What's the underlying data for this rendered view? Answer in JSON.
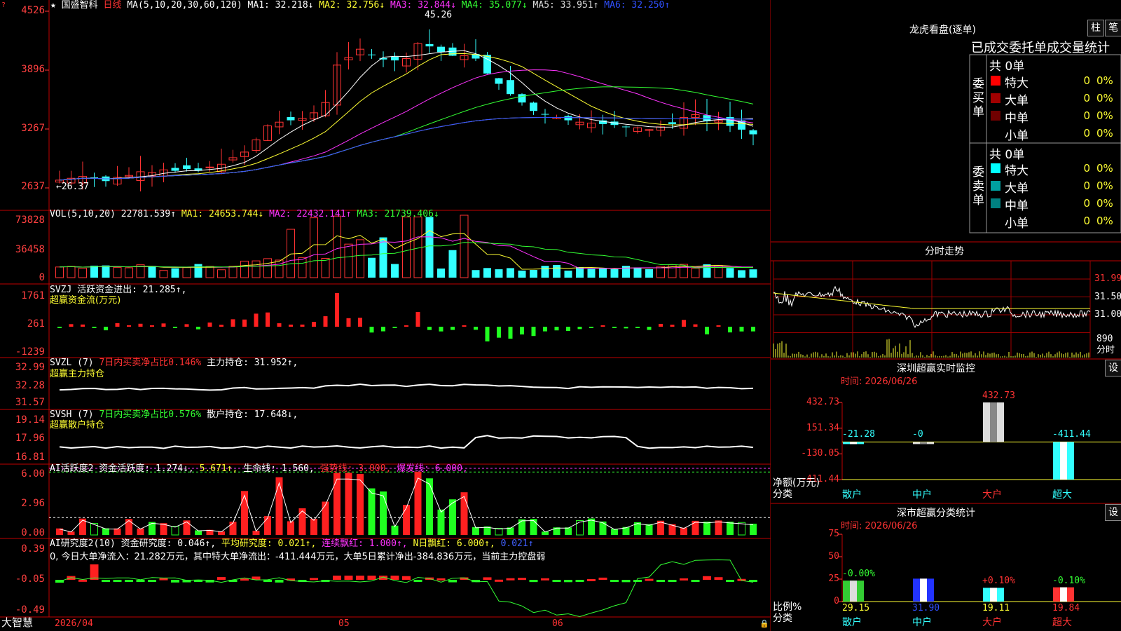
{
  "stock": {
    "star": "★",
    "name": "国盛智科",
    "period": "日线",
    "brand": "大智慧"
  },
  "main_chart": {
    "ma_label": "MA(5,10,20,30,60,120)",
    "ma": [
      {
        "name": "MA1:",
        "value": "32.218↓",
        "color": "#ffffff"
      },
      {
        "name": "MA2:",
        "value": "32.756↓",
        "color": "#ffff33"
      },
      {
        "name": "MA3:",
        "value": "32.844↓",
        "color": "#ff33ff"
      },
      {
        "name": "MA4:",
        "value": "35.077↓",
        "color": "#33ff33"
      },
      {
        "name": "MA5:",
        "value": "33.951↑",
        "color": "#dddddd"
      },
      {
        "name": "MA6:",
        "value": "32.250↑",
        "color": "#3050ff"
      }
    ],
    "y_ticks": [
      "4526",
      "3896",
      "3267",
      "2637"
    ],
    "high_label": "45.26",
    "low_label": "←26.37"
  },
  "vol": {
    "title": "VOL(5,10,20)",
    "value": "22781.539↑",
    "ma1": "MA1: 24653.744↓",
    "ma2": "MA2: 22432.141↑",
    "ma3": "MA3: 21739.406↓",
    "y_ticks": [
      "73828",
      "36458",
      "0"
    ]
  },
  "svzj": {
    "title": "SVZJ  活跃资金进出: 21.285↑,",
    "subtitle": "超赢资金流(万元)",
    "y_ticks": [
      "1761",
      "261",
      "-1239"
    ]
  },
  "svzl": {
    "title": "SVZL (7)",
    "pct": "7日内买卖净占比0.146%",
    "value": "主力持仓: 31.952↑,",
    "subtitle": "超赢主力持仓",
    "y_ticks": [
      "32.99",
      "32.28",
      "31.57"
    ]
  },
  "svsh": {
    "title": "SVSH (7)",
    "pct": "7日内买卖净占比0.576%",
    "value": "散户持仓: 17.648↓,",
    "subtitle": "超赢散户持仓",
    "y_ticks": [
      "19.14",
      "17.96",
      "16.81"
    ]
  },
  "ai1": {
    "title": "AI活跃度2 资金活跃度: 1.274↓,",
    "v2": "5.671",
    "life": "生命线: 1.560,",
    "strong": "强势线: 3.000,",
    "burst": "爆发线: 6.000,",
    "y_ticks": [
      "6.00",
      "2.96",
      "0.00"
    ]
  },
  "ai2": {
    "title": "AI研究度2(10) 资金研究度: 0.046↑,",
    "avg": "平均研究度: 0.021↑,",
    "red_streak": "连续飘红: 1.000↑,",
    "n_red": "N日飘红: 6.000↑,",
    "last": "0.021↑",
    "summary": "0, 今日大单净流入：21.282万元，其中特大单净流出：-411.444万元，大单5日累计净出-384.836万元，当前主力控盘弱",
    "y_ticks": [
      "0.39",
      "-0.05",
      "-0.49"
    ]
  },
  "x_axis": {
    "labels": [
      "2026/04",
      "05",
      "06"
    ]
  },
  "dragon": {
    "title": "龙虎看盘(逐单)",
    "btn1": "柱",
    "btn2": "笔",
    "subtitle": "已成交委托单成交量统计",
    "buy_label": "委买单",
    "sell_label": "委卖单",
    "buy_total": "共 0单",
    "sell_total": "共 0单",
    "buy": [
      {
        "label": "特大",
        "count": "0",
        "pct": "0%",
        "color": "#ff0000"
      },
      {
        "label": "大单",
        "count": "0",
        "pct": "0%",
        "color": "#a00000"
      },
      {
        "label": "中单",
        "count": "0",
        "pct": "0%",
        "color": "#700000"
      },
      {
        "label": "小单",
        "count": "0",
        "pct": "0%",
        "color": "#000000"
      }
    ],
    "sell": [
      {
        "label": "特大",
        "count": "0",
        "pct": "0%",
        "color": "#00ffff"
      },
      {
        "label": "大单",
        "count": "0",
        "pct": "0%",
        "color": "#00a0a0"
      },
      {
        "label": "中单",
        "count": "0",
        "pct": "0%",
        "color": "#008080"
      },
      {
        "label": "小单",
        "count": "0",
        "pct": "0%",
        "color": "#000000"
      }
    ]
  },
  "intraday": {
    "title": "分时走势",
    "y_ticks": [
      "31.99",
      "31.50",
      "31.00"
    ],
    "vol_tick": "890",
    "vol_label": "分时"
  },
  "sz_monitor": {
    "title": "深圳超赢实时监控",
    "settings": "设",
    "time": "时间: 2026/06/26",
    "y_ticks": [
      "432.73",
      "151.34",
      "-130.05",
      "-411.44"
    ],
    "y_label": "净额(万元)",
    "x_label": "分类",
    "categories": [
      "散户",
      "中户",
      "大户",
      "超大"
    ],
    "values": [
      -21.28,
      0,
      432.73,
      -411.44
    ],
    "value_labels": [
      "-21.28",
      "-0",
      "432.73",
      "-411.44"
    ]
  },
  "sz_class": {
    "title": "深市超赢分类统计",
    "settings": "设",
    "time": "时间: 2026/06/26",
    "y_ticks": [
      "75",
      "50",
      "25",
      "0"
    ],
    "y_label": "比例%",
    "x_label": "分类",
    "categories": [
      "散户",
      "中户",
      "大户",
      "超大"
    ],
    "values": [
      29.15,
      31.9,
      19.11,
      19.84
    ],
    "changes": [
      "-0.00%",
      "",
      "+0.10%",
      "-0.10%"
    ],
    "value_labels": [
      "29.15",
      "31.90",
      "19.11",
      "19.84"
    ]
  }
}
